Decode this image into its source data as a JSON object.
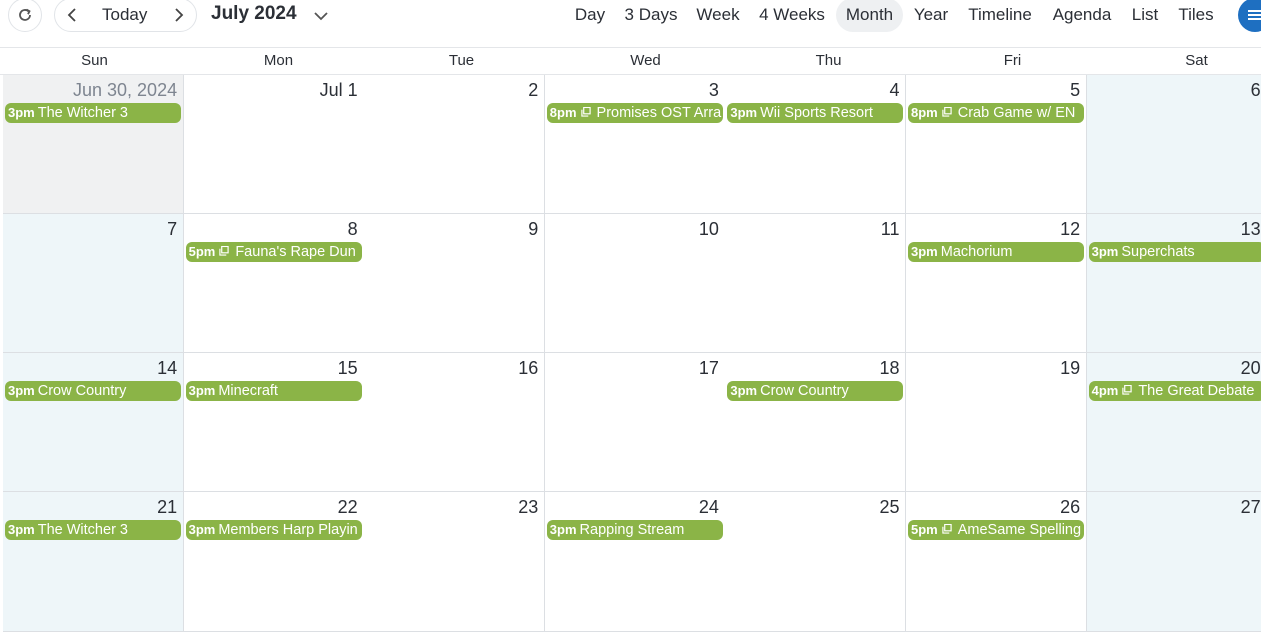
{
  "toolbar": {
    "today_label": "Today",
    "month_title": "July 2024",
    "views": [
      {
        "label": "Day"
      },
      {
        "label": "3 Days"
      },
      {
        "label": "Week"
      },
      {
        "label": "4 Weeks"
      },
      {
        "label": "Month"
      },
      {
        "label": "Year"
      },
      {
        "label": "Timeline"
      },
      {
        "label": "Agenda"
      },
      {
        "label": "List"
      },
      {
        "label": "Tiles"
      }
    ],
    "active_view": "Month",
    "icons": {
      "refresh": "refresh-icon",
      "prev": "chevron-left-icon",
      "next": "chevron-right-icon",
      "title_dropdown": "chevron-down-icon",
      "menu": "menu-icon"
    }
  },
  "weekdays": [
    "Sun",
    "Mon",
    "Tue",
    "Wed",
    "Thu",
    "Fri",
    "Sat"
  ],
  "colors": {
    "event": "#8bb447",
    "weekend": "#eef6f9",
    "other_month": "#f0f1f2",
    "accent": "#1e6fc1"
  },
  "weeks": [
    [
      {
        "date": "Jun 30, 2024",
        "event": {
          "time": "3pm",
          "title": "The Witcher 3",
          "recurring": false
        }
      },
      {
        "date": "Jul 1",
        "event": null
      },
      {
        "date": "2",
        "event": null
      },
      {
        "date": "3",
        "event": {
          "time": "8pm",
          "title": "Promises OST Arra",
          "recurring": true
        }
      },
      {
        "date": "4",
        "event": {
          "time": "3pm",
          "title": "Wii Sports Resort",
          "recurring": false
        }
      },
      {
        "date": "5",
        "event": {
          "time": "8pm",
          "title": "Crab Game w/ EN",
          "recurring": true
        }
      },
      {
        "date": "6",
        "event": null
      }
    ],
    [
      {
        "date": "7",
        "event": null
      },
      {
        "date": "8",
        "event": {
          "time": "5pm",
          "title": "Fauna's Rape Dun",
          "recurring": true
        }
      },
      {
        "date": "9",
        "event": null
      },
      {
        "date": "10",
        "event": null
      },
      {
        "date": "11",
        "event": null
      },
      {
        "date": "12",
        "event": {
          "time": "3pm",
          "title": "Machorium",
          "recurring": false
        }
      },
      {
        "date": "13",
        "event": {
          "time": "3pm",
          "title": "Superchats",
          "recurring": false
        }
      }
    ],
    [
      {
        "date": "14",
        "event": {
          "time": "3pm",
          "title": "Crow Country",
          "recurring": false
        }
      },
      {
        "date": "15",
        "event": {
          "time": "3pm",
          "title": "Minecraft",
          "recurring": false
        }
      },
      {
        "date": "16",
        "event": null
      },
      {
        "date": "17",
        "event": null
      },
      {
        "date": "18",
        "event": {
          "time": "3pm",
          "title": "Crow Country",
          "recurring": false
        }
      },
      {
        "date": "19",
        "event": null
      },
      {
        "date": "20",
        "event": {
          "time": "4pm",
          "title": "The Great Debate",
          "recurring": true
        }
      }
    ],
    [
      {
        "date": "21",
        "event": {
          "time": "3pm",
          "title": "The Witcher 3",
          "recurring": false
        }
      },
      {
        "date": "22",
        "event": {
          "time": "3pm",
          "title": "Members Harp Playin",
          "recurring": false
        }
      },
      {
        "date": "23",
        "event": null
      },
      {
        "date": "24",
        "event": {
          "time": "3pm",
          "title": "Rapping Stream",
          "recurring": false
        }
      },
      {
        "date": "25",
        "event": null
      },
      {
        "date": "26",
        "event": {
          "time": "5pm",
          "title": "AmeSame Spelling",
          "recurring": true
        }
      },
      {
        "date": "27",
        "event": null
      }
    ]
  ]
}
